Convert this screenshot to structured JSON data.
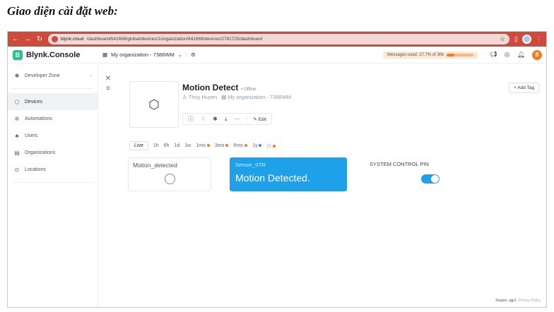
{
  "heading": "Giao diện cài đặt web:",
  "browser": {
    "url_host": "blynk.cloud",
    "url_path": "/dashboard/641668/global/devices/1/organization/641668/devices/2781725/dashboard"
  },
  "app": {
    "brand_letter": "B",
    "brand_name": "Blynk.Console",
    "org_name": "My organization - 7386WM",
    "messages_label": "Messages used: 27.7% of 30k",
    "messages_used_fraction": 0.277,
    "accent": "#23c48e",
    "avatar_letter": "8"
  },
  "sidebar": {
    "developer_zone": "Developer Zone",
    "items": [
      {
        "label": "Devices",
        "icon": "devices-icon",
        "active": true
      },
      {
        "label": "Automations",
        "icon": "automations-icon"
      },
      {
        "label": "Users",
        "icon": "users-icon"
      },
      {
        "label": "Organizations",
        "icon": "organizations-icon"
      },
      {
        "label": "Locations",
        "icon": "location-icon"
      }
    ]
  },
  "device": {
    "name": "Motion Detect",
    "status": "Offline",
    "owner": "Thuy Huyen",
    "org": "My organization - 7386WM",
    "edit_label": "Edit",
    "add_tag_label": "+ Add Tag"
  },
  "tabs": [
    {
      "label": "Live",
      "active": true
    },
    {
      "label": "1h"
    },
    {
      "label": "6h"
    },
    {
      "label": "1d"
    },
    {
      "label": "1w"
    },
    {
      "label": "1mo",
      "dot": "orange"
    },
    {
      "label": "3mo",
      "dot": "orange"
    },
    {
      "label": "6mo",
      "dot": "orange"
    },
    {
      "label": "1y",
      "dot": "blue"
    },
    {
      "label": "⁝⁝⁝",
      "dot": "orange"
    }
  ],
  "widgets": {
    "motion_title": "Motion_detected",
    "sensor_title": "Sensor_STR",
    "sensor_value": "Motion Detected.",
    "system_title": "SYSTEM CONTROL PIN",
    "system_switch_on": true,
    "widget_color": "#1ea1e8"
  },
  "footer": {
    "region": "Region: sgp1",
    "privacy": "Privacy Policy"
  }
}
